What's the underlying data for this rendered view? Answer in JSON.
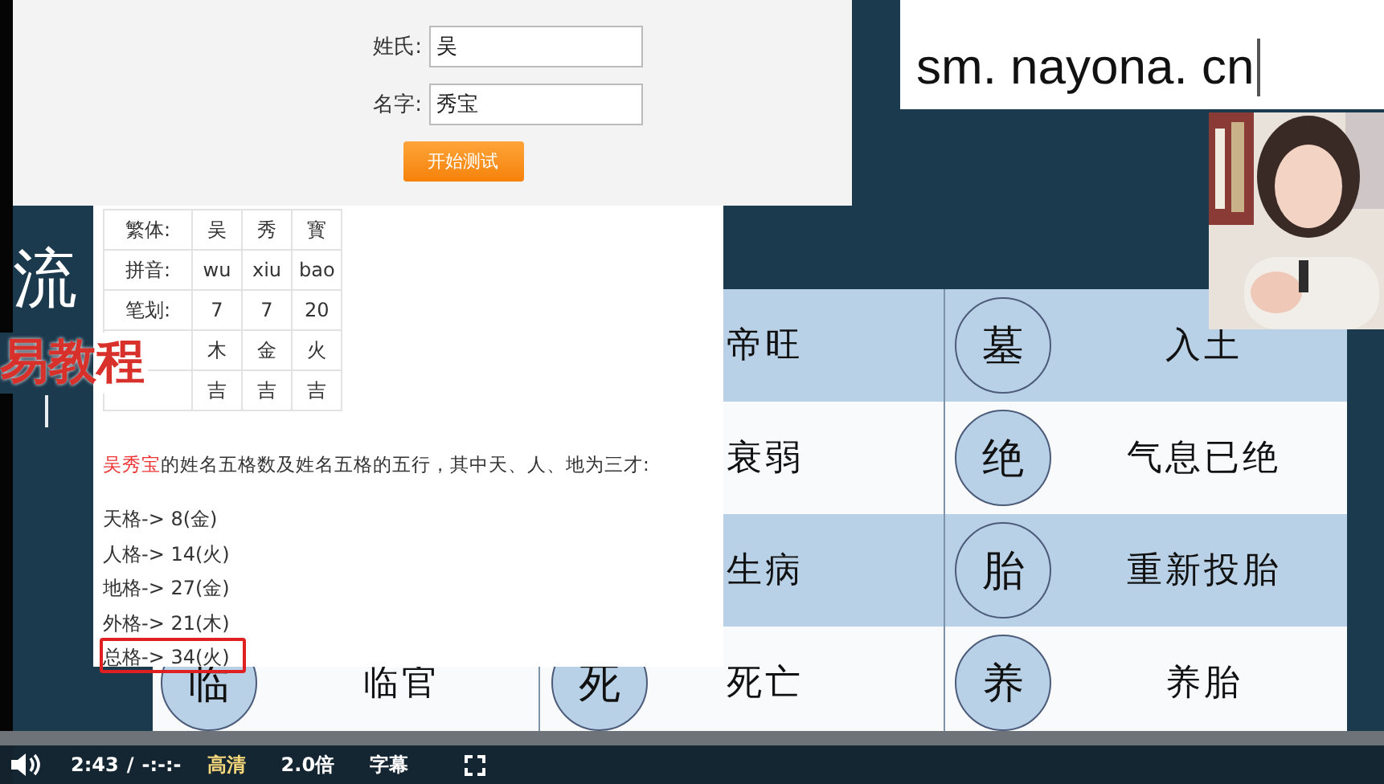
{
  "form": {
    "fields": [
      {
        "label": "姓氏:",
        "value": "吴"
      },
      {
        "label": "名字:",
        "value": "秀宝"
      }
    ],
    "button": "开始测试"
  },
  "result": {
    "table": [
      {
        "label": "繁体:",
        "cells": [
          "吴",
          "秀",
          "寳"
        ]
      },
      {
        "label": "拼音:",
        "cells": [
          "wu",
          "xiu",
          "bao"
        ]
      },
      {
        "label": "笔划:",
        "cells": [
          "7",
          "7",
          "20"
        ]
      },
      {
        "cells": [
          "木",
          "金",
          "火"
        ]
      },
      {
        "cells": [
          "吉",
          "吉",
          "吉"
        ]
      }
    ],
    "summary": {
      "name": "吴秀宝",
      "text": "的姓名五格数及姓名五格的五行，其中天、人、地为三才:"
    },
    "grids": [
      {
        "text": "天格-> 8(金)",
        "boxed": false
      },
      {
        "text": "人格-> 14(火)",
        "boxed": false
      },
      {
        "text": "地格-> 27(金)",
        "boxed": false
      },
      {
        "text": "外格-> 21(木)",
        "boxed": false
      },
      {
        "text": "总格-> 34(火)",
        "boxed": true
      }
    ]
  },
  "slide": {
    "heading": "流",
    "title": "易教程",
    "rows": [
      {
        "shaded": true,
        "col_2_text": "帝旺",
        "col_3_circle": "墓",
        "col_3_text": "入土"
      },
      {
        "shaded": false,
        "col_2_text": "衰弱",
        "col_3_circle": "绝",
        "col_3_text": "气息已绝"
      },
      {
        "shaded": true,
        "col_2_text": "生病",
        "col_3_circle": "胎",
        "col_3_text": "重新投胎"
      },
      {
        "shaded": false,
        "col_1_circle": "临",
        "col_1_text": "临官",
        "col_2_circle": "死",
        "col_2_text": "死亡",
        "col_3_circle": "养",
        "col_3_text": "养胎"
      }
    ]
  },
  "banner": {
    "text": "sm. nayona. cn"
  },
  "player": {
    "time": "2:43",
    "separator": "/",
    "duration": "-:-:-",
    "quality": {
      "label": "高清",
      "selected": true
    },
    "speed": "2.0倍",
    "subtitles": "字幕"
  }
}
